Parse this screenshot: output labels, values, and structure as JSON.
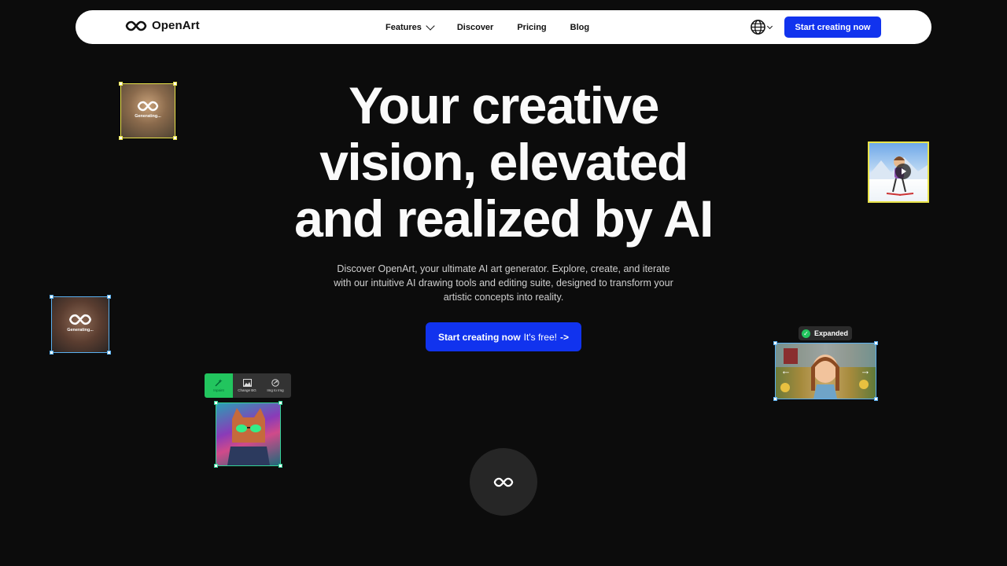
{
  "nav": {
    "logo_text": "OpenArt",
    "links": [
      {
        "label": "Features"
      },
      {
        "label": "Discover"
      },
      {
        "label": "Pricing"
      },
      {
        "label": "Blog"
      }
    ],
    "cta_label": "Start creating now",
    "language_icon": "globe-icon"
  },
  "hero": {
    "title_lines": [
      "Your creative",
      "vision, elevated",
      "and realized by AI"
    ],
    "description": "Discover OpenArt, your ultimate AI art generator. Explore, create, and iterate with our intuitive AI drawing tools and editing suite, designed to transform your artistic concepts into reality.",
    "cta_main": "Start creating now",
    "cta_free": "It's free!",
    "cta_arrow": "->"
  },
  "cards": {
    "cat_generating": "Generating...",
    "person_generating": "Generating...",
    "toolbar": [
      {
        "label": "Inpaint",
        "icon": "magic-wand-icon"
      },
      {
        "label": "Change BG",
        "icon": "image-icon"
      },
      {
        "label": "Img to Img",
        "icon": "swap-icon"
      }
    ],
    "expanded_label": "Expanded"
  },
  "colors": {
    "accent": "#1133ee",
    "yellow_selection": "#e9e34a",
    "blue_selection": "#5ab0f0",
    "green_selection": "#34d399",
    "background": "#0c0c0c"
  }
}
